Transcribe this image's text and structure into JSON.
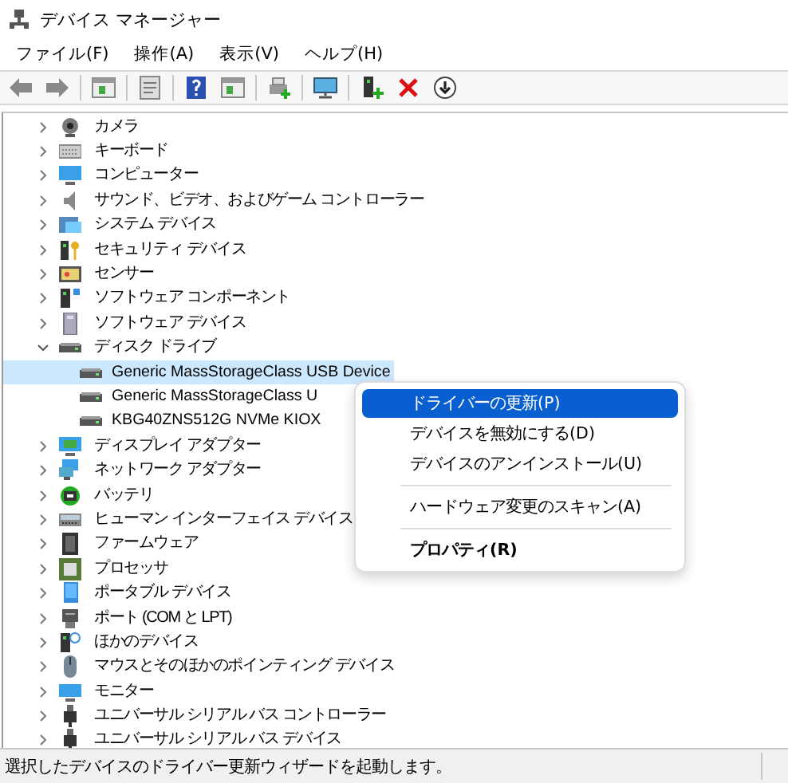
{
  "window": {
    "title": "デバイス マネージャー"
  },
  "menu": [
    "ファイル(F)",
    "操作(A)",
    "表示(V)",
    "ヘルプ(H)"
  ],
  "tree": [
    {
      "label": "カメラ",
      "expanded": false,
      "selected": false
    },
    {
      "label": "キーボード",
      "expanded": false,
      "selected": false
    },
    {
      "label": "コンピューター",
      "expanded": false,
      "selected": false
    },
    {
      "label": "サウンド、ビデオ、およびゲーム コントローラー",
      "expanded": false,
      "selected": false
    },
    {
      "label": "システム デバイス",
      "expanded": false,
      "selected": false
    },
    {
      "label": "セキュリティ デバイス",
      "expanded": false,
      "selected": false
    },
    {
      "label": "センサー",
      "expanded": false,
      "selected": false
    },
    {
      "label": "ソフトウェア コンポーネント",
      "expanded": false,
      "selected": false
    },
    {
      "label": "ソフトウェア デバイス",
      "expanded": false,
      "selected": false
    },
    {
      "label": "ディスク ドライブ",
      "expanded": true,
      "selected": false,
      "children": [
        {
          "label": "Generic MassStorageClass USB Device",
          "selected": true
        },
        {
          "label": "Generic MassStorageClass U",
          "selected": false
        },
        {
          "label": "KBG40ZNS512G NVMe KIOX",
          "selected": false
        }
      ]
    },
    {
      "label": "ディスプレイ アダプター",
      "expanded": false,
      "selected": false
    },
    {
      "label": "ネットワーク アダプター",
      "expanded": false,
      "selected": false
    },
    {
      "label": "バッテリ",
      "expanded": false,
      "selected": false
    },
    {
      "label": "ヒューマン インターフェイス デバイス",
      "expanded": false,
      "selected": false
    },
    {
      "label": "ファームウェア",
      "expanded": false,
      "selected": false
    },
    {
      "label": "プロセッサ",
      "expanded": false,
      "selected": false
    },
    {
      "label": "ポータブル デバイス",
      "expanded": false,
      "selected": false
    },
    {
      "label": "ポート (COM と LPT)",
      "expanded": false,
      "selected": false
    },
    {
      "label": "ほかのデバイス",
      "expanded": false,
      "selected": false
    },
    {
      "label": "マウスとそのほかのポインティング デバイス",
      "expanded": false,
      "selected": false
    },
    {
      "label": "モニター",
      "expanded": false,
      "selected": false
    },
    {
      "label": "ユニバーサル シリアル バス コントローラー",
      "expanded": false,
      "selected": false
    },
    {
      "label": "ユニバーサル シリアル バス デバイス",
      "expanded": false,
      "selected": false
    }
  ],
  "context_menu": [
    [
      {
        "label": "ドライバーの更新(P)",
        "selected": true,
        "default": false
      },
      {
        "label": "デバイスを無効にする(D)",
        "selected": false,
        "default": false
      },
      {
        "label": "デバイスのアンインストール(U)",
        "selected": false,
        "default": false
      }
    ],
    [
      {
        "label": "ハードウェア変更のスキャン(A)",
        "selected": false,
        "default": false
      }
    ],
    [
      {
        "label": "プロパティ(R)",
        "selected": false,
        "default": true
      }
    ]
  ],
  "status_bar": "選択したデバイスのドライバー更新ウィザードを起動します。"
}
